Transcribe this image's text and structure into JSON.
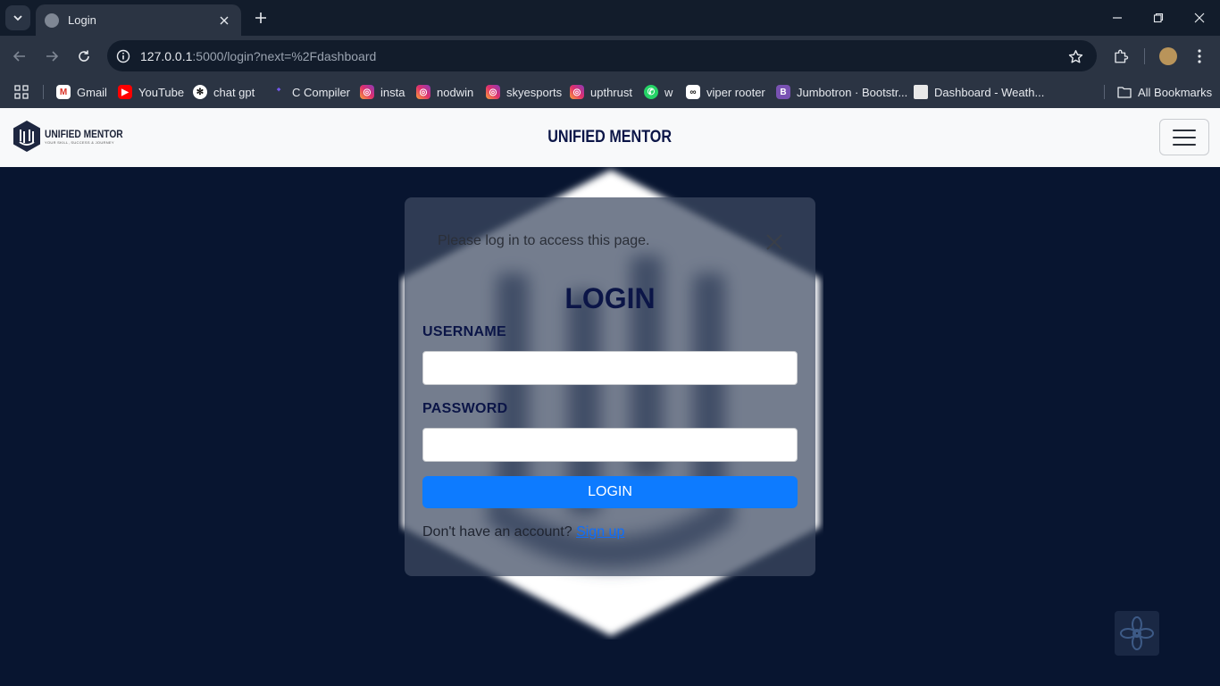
{
  "browser": {
    "tab_title": "Login",
    "url_host": "127.0.0.1",
    "url_rest": ":5000/login?next=%2Fdashboard",
    "bookmarks": [
      {
        "label": "Gmail",
        "icon": "gmail-icon"
      },
      {
        "label": "YouTube",
        "icon": "youtube-icon"
      },
      {
        "label": "chat gpt",
        "icon": "chatgpt-icon"
      },
      {
        "label": "C Compiler",
        "icon": "compiler-icon"
      },
      {
        "label": "insta",
        "icon": "instagram-icon"
      },
      {
        "label": "nodwin",
        "icon": "instagram-icon"
      },
      {
        "label": "skyesports",
        "icon": "instagram-icon"
      },
      {
        "label": "upthrust",
        "icon": "instagram-icon"
      },
      {
        "label": "w",
        "icon": "whatsapp-icon"
      },
      {
        "label": "viper rooter",
        "icon": "viper-icon"
      },
      {
        "label": "Jumbotron · Bootstr...",
        "icon": "bootstrap-icon"
      },
      {
        "label": "Dashboard - Weath...",
        "icon": "page-icon"
      }
    ],
    "all_bookmarks_label": "All Bookmarks"
  },
  "navbar": {
    "brand_name": "UNIFIED MENTOR",
    "brand_tagline": "YOUR SKILL, SUCCESS & JOURNEY",
    "title": "UNIFIED MENTOR"
  },
  "login": {
    "alert_text": "Please log in to access this page.",
    "title": "LOGIN",
    "username_label": "USERNAME",
    "username_value": "",
    "password_label": "PASSWORD",
    "password_value": "",
    "submit_label": "LOGIN",
    "signup_prompt": "Don't have an account?",
    "signup_link": "Sign up"
  },
  "colors": {
    "page_bg": "#081530",
    "navbar_bg": "#f8f9fa",
    "title_color": "#0b1547",
    "button_blue": "#0d7bff",
    "link_blue": "#0d6efd"
  }
}
